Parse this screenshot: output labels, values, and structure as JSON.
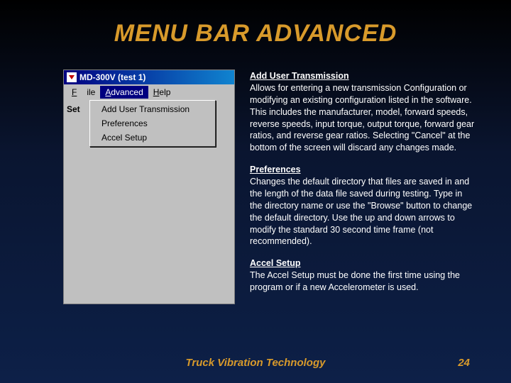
{
  "title": "MENU BAR ADVANCED",
  "win98": {
    "title": "MD-300V (test 1)",
    "menubar": {
      "file": "File",
      "advanced": "Advanced",
      "help": "Help"
    },
    "bglabel": "Set",
    "dropdown": {
      "add_user_transmission": "Add User Transmission",
      "preferences": "Preferences",
      "accel_setup": "Accel Setup"
    }
  },
  "sections": {
    "s1": {
      "heading": "Add User Transmission",
      "body": "Allows for entering a new transmission Configuration or modifying an existing configuration listed in the software. This includes the manufacturer, model, forward speeds, reverse speeds, input torque, output torque, forward gear ratios, and reverse gear ratios. Selecting \"Cancel\" at the bottom of the screen will discard any changes made."
    },
    "s2": {
      "heading": "Preferences",
      "body": "Changes the default directory that files are saved in and the length of the data file saved during testing. Type in the directory name or use the \"Browse\" button to change the default directory. Use the up and down arrows to modify the standard 30 second time frame (not recommended)."
    },
    "s3": {
      "heading": "Accel Setup",
      "body": "The Accel Setup must be done the first time using the program or if a new Accelerometer is used."
    }
  },
  "footer": {
    "name": "Truck Vibration Technology",
    "page": "24"
  }
}
